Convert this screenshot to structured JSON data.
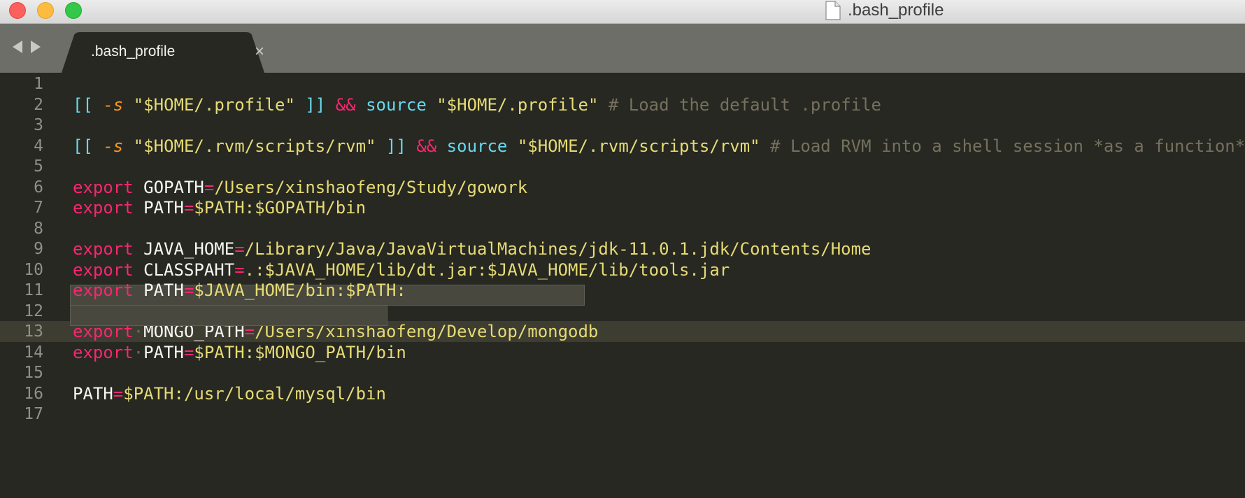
{
  "window": {
    "title": ".bash_profile"
  },
  "tab": {
    "label": ".bash_profile",
    "close_glyph": "×"
  },
  "colors": {
    "background": "#272822",
    "keyword": "#f92672",
    "builtin": "#66d9ef",
    "flag": "#fd971f",
    "string": "#e6db74",
    "comment": "#75715e",
    "text": "#f8f8f2",
    "gutter": "#90908a"
  },
  "editor": {
    "active_line": 13,
    "lines": [
      {
        "n": "1",
        "tokens": []
      },
      {
        "n": "2",
        "tokens": [
          {
            "t": "[[ ",
            "c": "b"
          },
          {
            "t": "-s",
            "c": "f"
          },
          {
            "t": " ",
            "c": "w"
          },
          {
            "t": "\"$HOME/.profile\"",
            "c": "s"
          },
          {
            "t": " ]]",
            "c": "b"
          },
          {
            "t": " ",
            "c": "w"
          },
          {
            "t": "&&",
            "c": "o"
          },
          {
            "t": " ",
            "c": "w"
          },
          {
            "t": "source",
            "c": "c"
          },
          {
            "t": " ",
            "c": "w"
          },
          {
            "t": "\"$HOME/.profile\"",
            "c": "s"
          },
          {
            "t": " # Load the default .profile",
            "c": "cm"
          }
        ]
      },
      {
        "n": "3",
        "tokens": []
      },
      {
        "n": "4",
        "tokens": [
          {
            "t": "[[ ",
            "c": "b"
          },
          {
            "t": "-s",
            "c": "f"
          },
          {
            "t": " ",
            "c": "w"
          },
          {
            "t": "\"$HOME/.rvm/scripts/rvm\"",
            "c": "s"
          },
          {
            "t": " ]]",
            "c": "b"
          },
          {
            "t": " ",
            "c": "w"
          },
          {
            "t": "&&",
            "c": "o"
          },
          {
            "t": " ",
            "c": "w"
          },
          {
            "t": "source",
            "c": "c"
          },
          {
            "t": " ",
            "c": "w"
          },
          {
            "t": "\"$HOME/.rvm/scripts/rvm\"",
            "c": "s"
          },
          {
            "t": " # Load RVM into a shell session *as a function*",
            "c": "cm"
          }
        ]
      },
      {
        "n": "5",
        "tokens": []
      },
      {
        "n": "6",
        "tokens": [
          {
            "t": "export",
            "c": "k"
          },
          {
            "t": " GOPATH",
            "c": "w"
          },
          {
            "t": "=",
            "c": "o"
          },
          {
            "t": "/Users/xinshaofeng/Study/gowork",
            "c": "s"
          }
        ]
      },
      {
        "n": "7",
        "tokens": [
          {
            "t": "export",
            "c": "k"
          },
          {
            "t": " PATH",
            "c": "w"
          },
          {
            "t": "=",
            "c": "o"
          },
          {
            "t": "$PATH:$GOPATH/bin",
            "c": "s"
          }
        ]
      },
      {
        "n": "8",
        "tokens": []
      },
      {
        "n": "9",
        "tokens": [
          {
            "t": "export",
            "c": "k"
          },
          {
            "t": " JAVA_HOME",
            "c": "w"
          },
          {
            "t": "=",
            "c": "o"
          },
          {
            "t": "/Library/Java/JavaVirtualMachines/jdk-11.0.1.jdk/Contents/Home",
            "c": "s"
          }
        ]
      },
      {
        "n": "10",
        "tokens": [
          {
            "t": "export",
            "c": "k"
          },
          {
            "t": " CLASSPAHT",
            "c": "w"
          },
          {
            "t": "=",
            "c": "o"
          },
          {
            "t": ".:$JAVA_HOME/lib/dt.jar:$JAVA_HOME/lib/tools.jar",
            "c": "s"
          }
        ]
      },
      {
        "n": "11",
        "tokens": [
          {
            "t": "export",
            "c": "k"
          },
          {
            "t": " PATH",
            "c": "w"
          },
          {
            "t": "=",
            "c": "o"
          },
          {
            "t": "$JAVA_HOME/bin:$PATH:",
            "c": "s"
          }
        ]
      },
      {
        "n": "12",
        "tokens": []
      },
      {
        "n": "13",
        "tokens": [
          {
            "t": "export",
            "c": "k"
          },
          {
            "t": "·",
            "c": "dot"
          },
          {
            "t": "MONGO_PATH",
            "c": "w"
          },
          {
            "t": "=",
            "c": "o"
          },
          {
            "t": "/Users/xinshaofeng/Develop/mongodb",
            "c": "s"
          }
        ]
      },
      {
        "n": "14",
        "tokens": [
          {
            "t": "export",
            "c": "k"
          },
          {
            "t": "·",
            "c": "dot"
          },
          {
            "t": "PATH",
            "c": "w"
          },
          {
            "t": "=",
            "c": "o"
          },
          {
            "t": "$PATH:$MONGO_PATH/bin",
            "c": "s"
          }
        ]
      },
      {
        "n": "15",
        "tokens": []
      },
      {
        "n": "16",
        "tokens": [
          {
            "t": "PATH",
            "c": "w"
          },
          {
            "t": "=",
            "c": "o"
          },
          {
            "t": "$PATH:/usr/local/mysql/bin",
            "c": "s"
          }
        ]
      },
      {
        "n": "17",
        "tokens": []
      }
    ]
  }
}
